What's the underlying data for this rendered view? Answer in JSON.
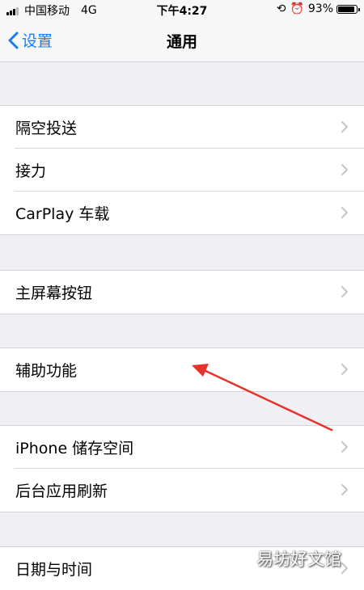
{
  "status_bar": {
    "carrier": "中国移动",
    "network": "4G",
    "time": "下午4:27",
    "battery": "93%",
    "battery_level": 0.93,
    "icons": [
      "signal-icon",
      "rotation-lock-icon",
      "alarm-icon",
      "battery-icon"
    ]
  },
  "nav": {
    "back_label": "设置",
    "title": "通用"
  },
  "groups": [
    {
      "items": [
        "隔空投送",
        "接力",
        "CarPlay 车载"
      ]
    },
    {
      "items": [
        "主屏幕按钮"
      ]
    },
    {
      "items": [
        "辅助功能"
      ]
    },
    {
      "items": [
        "iPhone 储存空间",
        "后台应用刷新"
      ]
    },
    {
      "items": [
        "日期与时间"
      ]
    }
  ],
  "watermark": "易坊好文馆",
  "colors": {
    "accent": "#1a7cf5",
    "background": "#efeff4",
    "annotation_arrow": "#e8312a",
    "chevron": "#c7c7cc"
  }
}
